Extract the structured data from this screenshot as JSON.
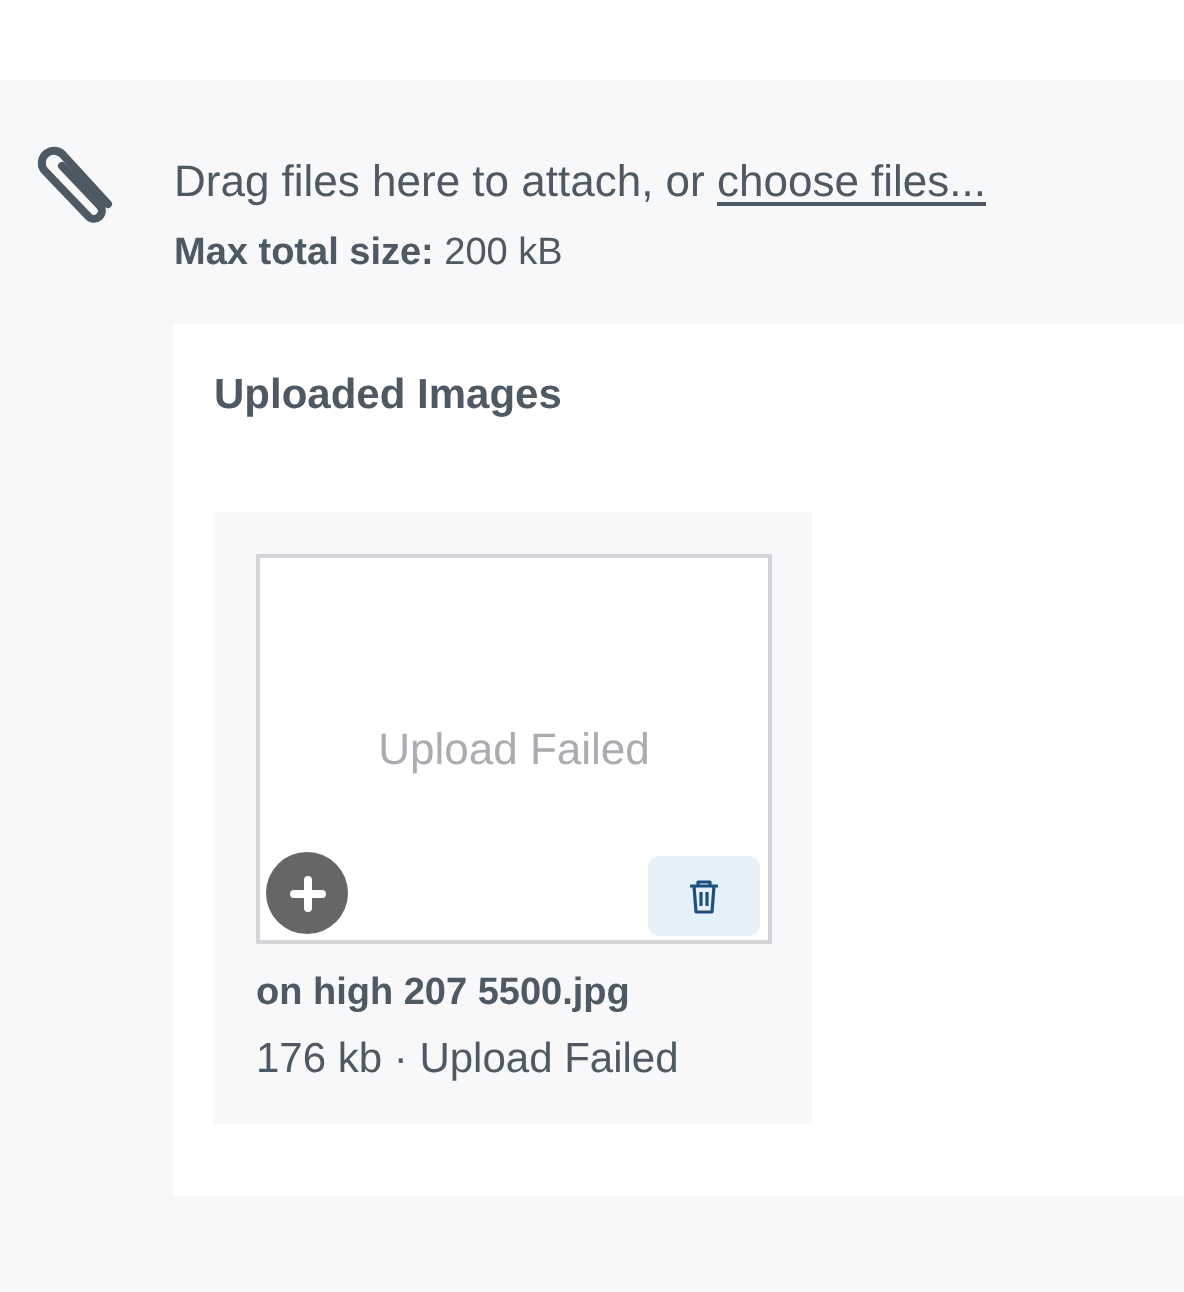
{
  "attach": {
    "prompt": "Drag files here to attach, or",
    "link": "choose files...",
    "limit": "**Max total size:** 200 kB"
  },
  "gallery": {
    "title": "Uploaded Images",
    "images": [
      {
        "status_text": "Upload Failed",
        "filename": "on high 207 5500.jpg",
        "meta": "176 kb · Upload Failed"
      }
    ]
  }
}
